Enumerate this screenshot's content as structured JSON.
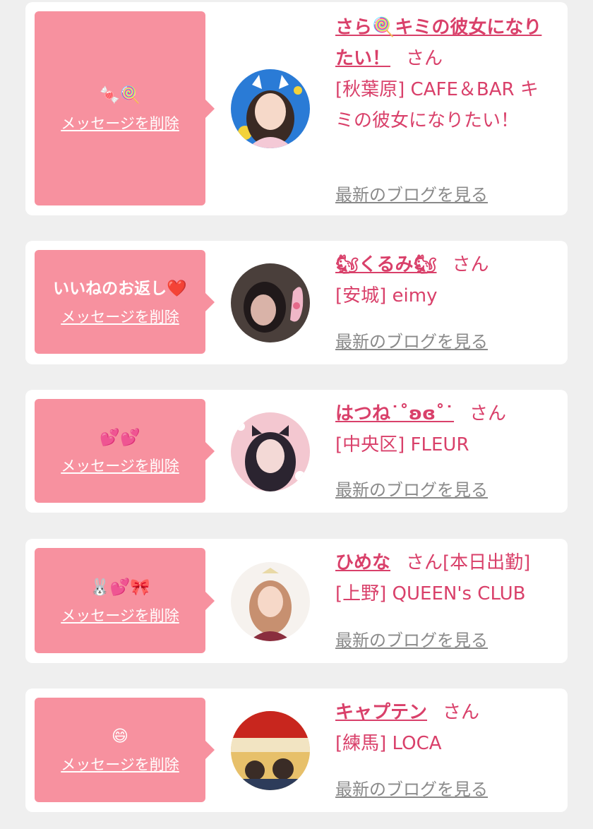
{
  "cards": [
    {
      "bubble_message": "🍬🍭",
      "delete_label": "メッセージを削除",
      "name": "さら🍭キミの彼女になりたい！",
      "san": "さん",
      "shop": "[秋葉原] CAFE＆BAR キミの彼女になりたい！",
      "blog_label": "最新のブログを見る",
      "avatar_colors": [
        "#2a7bd6",
        "#f4d6d6"
      ]
    },
    {
      "bubble_message": "いいねのお返し❤️",
      "delete_label": "メッセージを削除",
      "name": "🐿くるみ🐿",
      "san": "さん",
      "shop": "[安城] eimy",
      "blog_label": "最新のブログを見る",
      "avatar_colors": [
        "#3a3331",
        "#e7b7c4"
      ]
    },
    {
      "bubble_message": "💕💕",
      "delete_label": "メッセージを削除",
      "name": "はつね˙˚ʚɞ˚˙",
      "san": "さん",
      "shop": "[中央区] FLEUR",
      "blog_label": "最新のブログを見る",
      "avatar_colors": [
        "#f3c7d0",
        "#2b2430"
      ]
    },
    {
      "bubble_message": "🐰💕🎀",
      "delete_label": "メッセージを削除",
      "name": "ひめな",
      "san": "さん[本日出勤]",
      "shop": "[上野] QUEEN's CLUB",
      "blog_label": "最新のブログを見る",
      "avatar_colors": [
        "#f6f2ee",
        "#c79070"
      ]
    },
    {
      "bubble_message": "😄",
      "delete_label": "メッセージを削除",
      "name": "キャプテン",
      "san": "さん",
      "shop": "[練馬] LOCA",
      "blog_label": "最新のブログを見る",
      "avatar_colors": [
        "#c8261e",
        "#e7c06a"
      ]
    }
  ],
  "colors": {
    "page_bg": "#efefef",
    "card_bg": "#ffffff",
    "bubble_bg": "#f7919f",
    "accent_text": "#d9406a",
    "link_gray": "#8a8a8a"
  }
}
